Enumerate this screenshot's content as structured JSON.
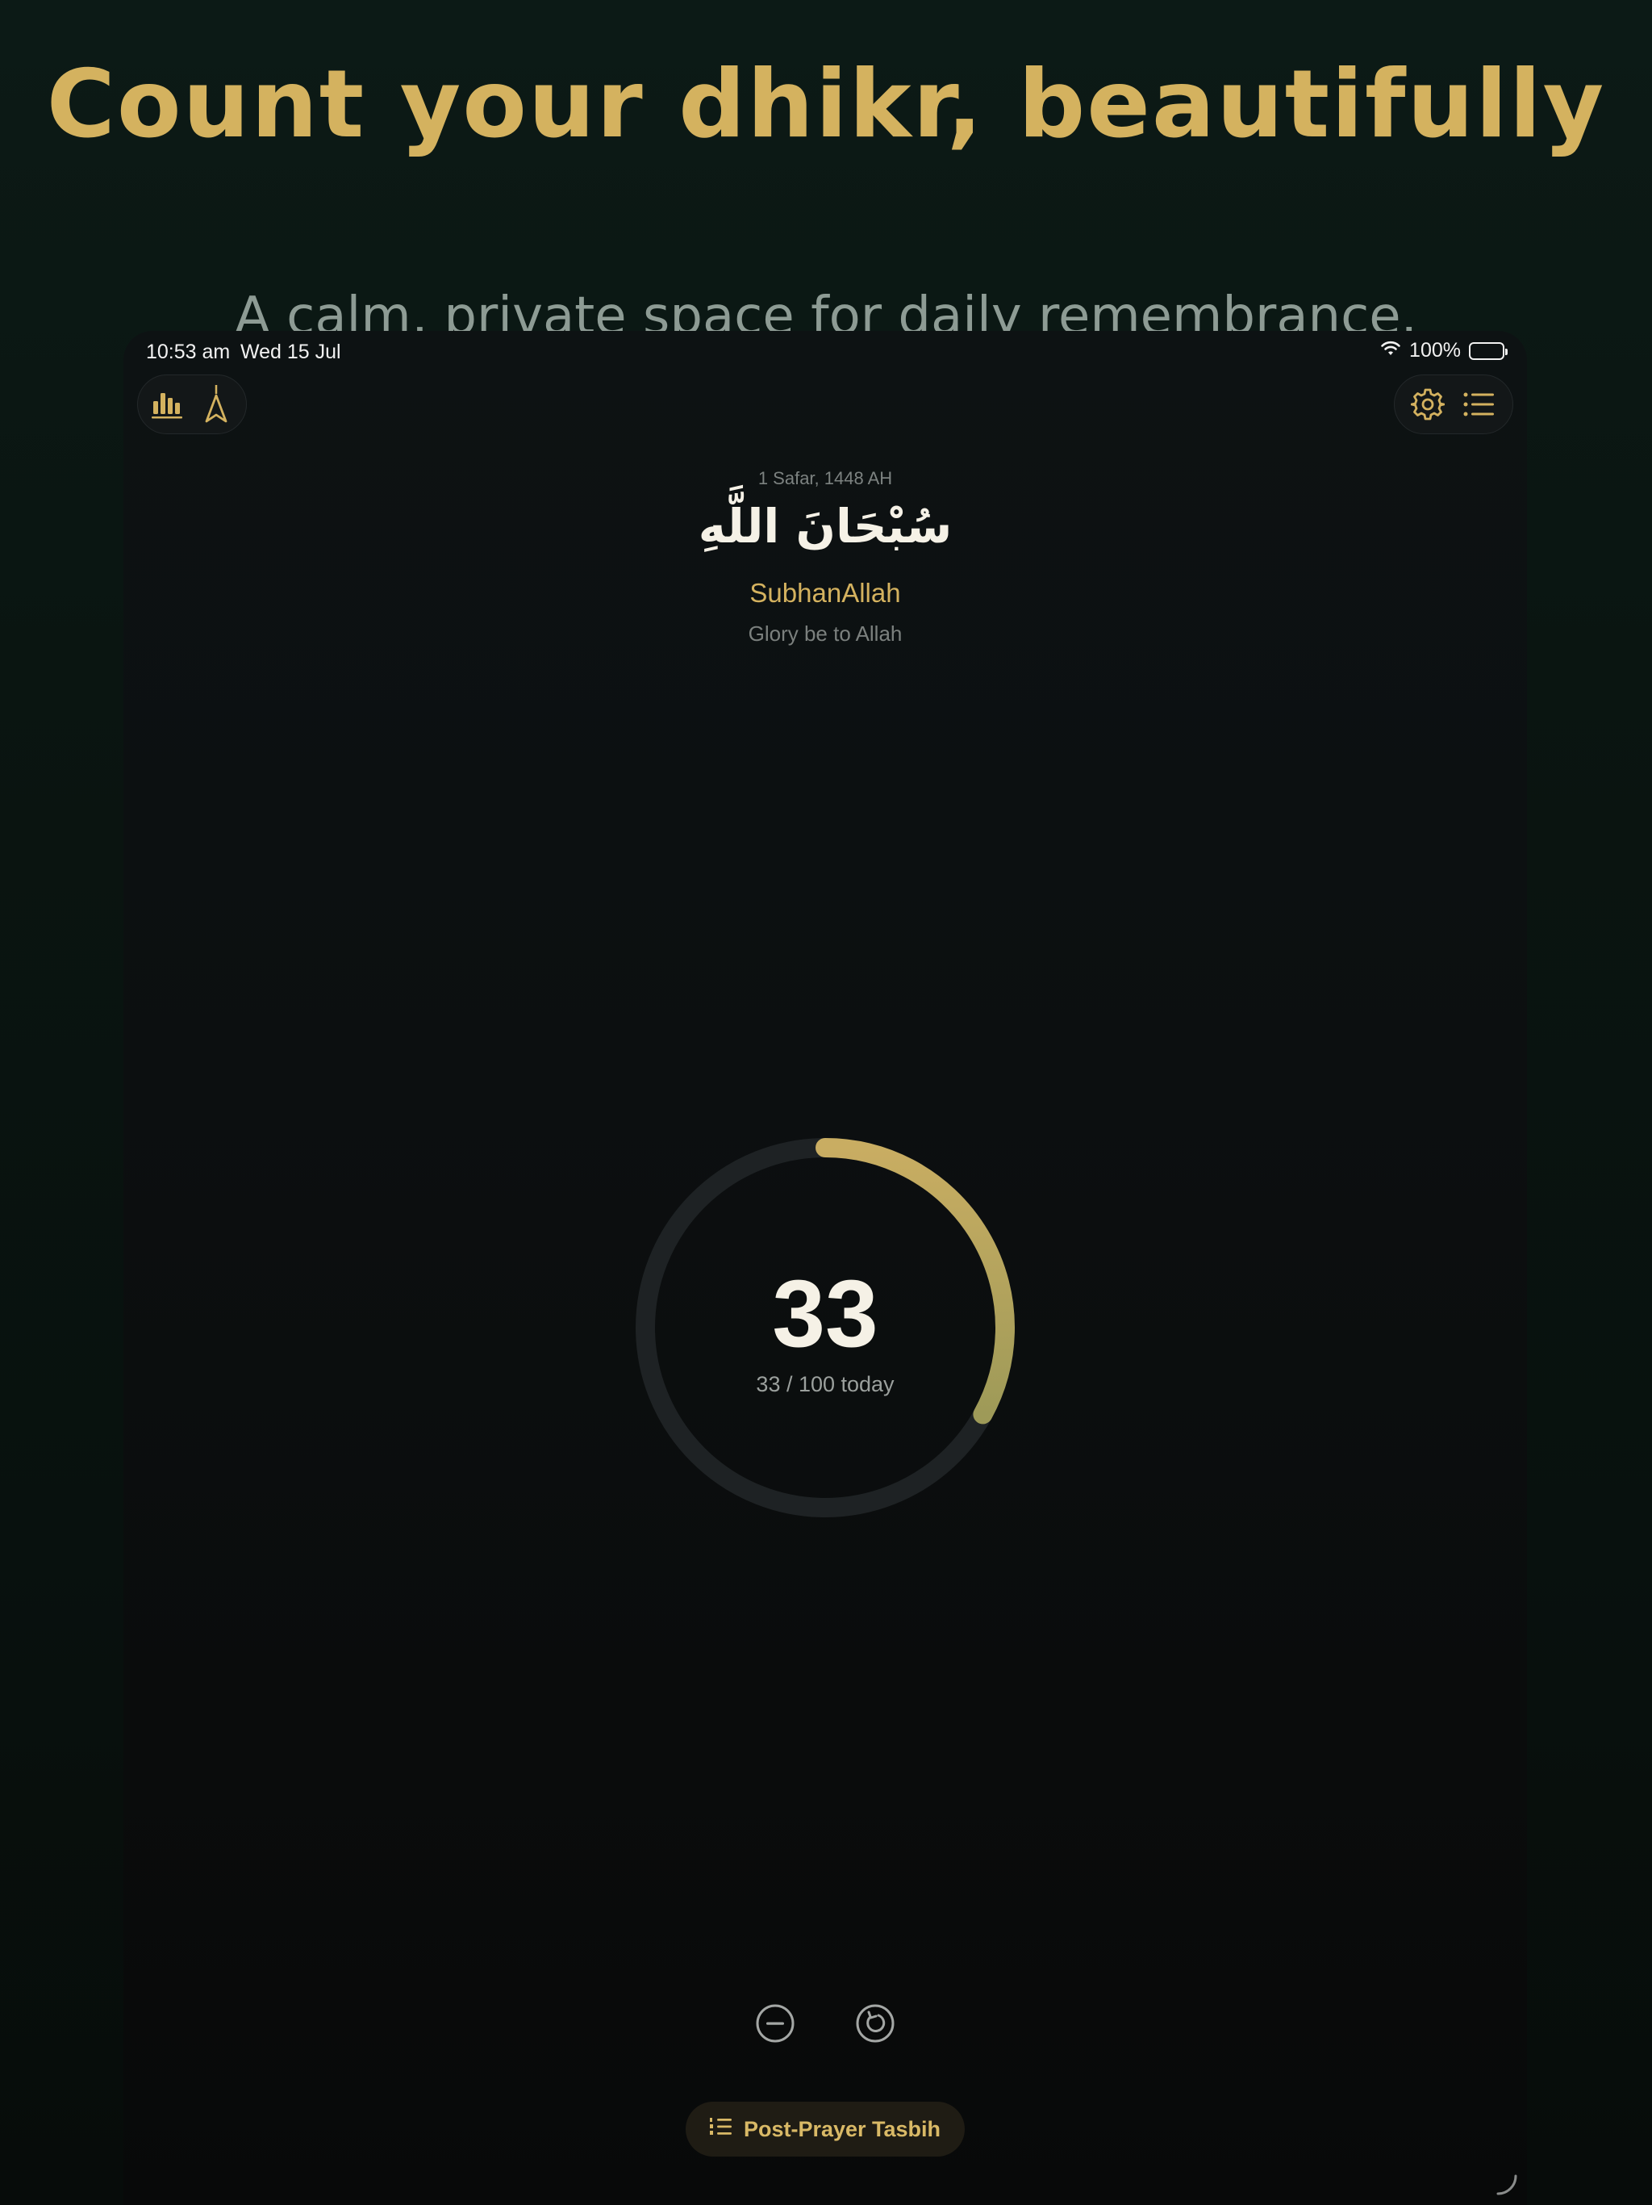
{
  "hero": {
    "title": "Count your dhikr, beautifully",
    "subtitle": "A calm, private space for daily remembrance."
  },
  "status_bar": {
    "time": "10:53 am",
    "date": "Wed 15 Jul",
    "battery": "100%"
  },
  "toolbar": {
    "left_icons": [
      "stats-icon",
      "qibla-compass-icon"
    ],
    "right_icons": [
      "settings-icon",
      "list-icon"
    ]
  },
  "dhikr": {
    "hijri_date": "1 Safar, 1448 AH",
    "arabic": "سُبْحَانَ اللَّهِ",
    "transliteration": "SubhanAllah",
    "translation": "Glory be to Allah"
  },
  "counter": {
    "count": "33",
    "progress_label": "33 / 100 today",
    "progress_fraction": 0.33
  },
  "controls": {
    "decrement_icon": "minus-circle-icon",
    "reset_icon": "reset-icon"
  },
  "preset": {
    "label": "Post-Prayer Tasbih",
    "icon": "numbered-list-icon"
  },
  "colors": {
    "accent_gold": "#d4b25f",
    "ring_track": "#1e2224",
    "ring_progress_start": "#c9ad62",
    "ring_progress_end": "#9e9a58"
  }
}
